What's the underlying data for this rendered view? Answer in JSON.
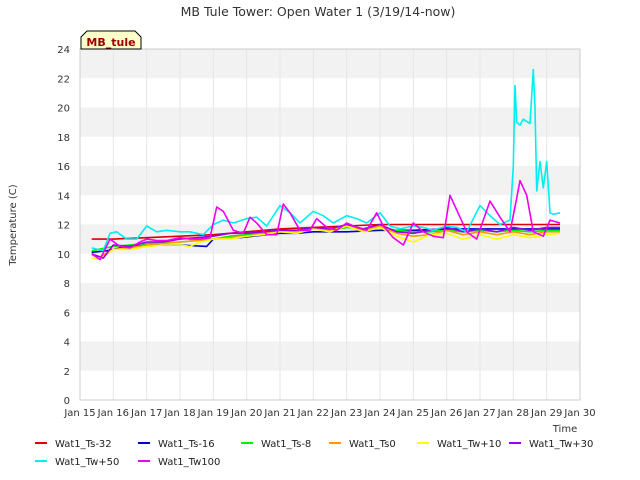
{
  "chart_data": {
    "type": "line",
    "title": "MB Tule Tower: Open Water 1 (3/19/14-now)",
    "site_label": "MB_tule",
    "xlabel": "Time",
    "ylabel": "Temperature (C)",
    "xlim": [
      15,
      30
    ],
    "ylim": [
      0,
      24
    ],
    "x_ticks": [
      15,
      16,
      17,
      18,
      19,
      20,
      21,
      22,
      23,
      24,
      25,
      26,
      27,
      28,
      29,
      30
    ],
    "x_tick_labels": [
      "Jan 15",
      "Jan 16",
      "Jan 17",
      "Jan 18",
      "Jan 19",
      "Jan 20",
      "Jan 21",
      "Jan 22",
      "Jan 23",
      "Jan 24",
      "Jan 25",
      "Jan 26",
      "Jan 27",
      "Jan 28",
      "Jan 29",
      "Jan 30"
    ],
    "y_ticks": [
      0,
      2,
      4,
      6,
      8,
      10,
      12,
      14,
      16,
      18,
      20,
      22,
      24
    ],
    "y_tick_labels": [
      "0",
      "2",
      "4",
      "6",
      "8",
      "10",
      "12",
      "14",
      "16",
      "18",
      "20",
      "22",
      "24"
    ],
    "grid": true,
    "legend_position": "bottom",
    "series": [
      {
        "name": "Wat1_Ts-32",
        "color": "#dd0000",
        "x": [
          15.35,
          16,
          17,
          18,
          19,
          20,
          21,
          22,
          23,
          24,
          25,
          26,
          27,
          28,
          29,
          29.4
        ],
        "y": [
          11.0,
          11.0,
          11.1,
          11.2,
          11.3,
          11.5,
          11.7,
          11.8,
          11.9,
          12.0,
          12.0,
          12.0,
          12.0,
          12.0,
          12.0,
          12.0
        ]
      },
      {
        "name": "Wat1_Ts-16",
        "color": "#0000cc",
        "x": [
          15.35,
          15.8,
          16.2,
          17,
          18,
          18.8,
          19,
          19.8,
          20.2,
          21,
          21.5,
          22,
          23,
          24,
          25,
          26,
          27,
          28,
          29,
          29.4
        ],
        "y": [
          10.1,
          10.2,
          10.4,
          10.6,
          10.6,
          10.5,
          11.0,
          11.1,
          11.2,
          11.4,
          11.4,
          11.5,
          11.5,
          11.6,
          11.6,
          11.7,
          11.7,
          11.7,
          11.7,
          11.7
        ]
      },
      {
        "name": "Wat1_Ts-8",
        "color": "#00ee00",
        "x": [
          15.35,
          16,
          17,
          18,
          19,
          19.5,
          20,
          20.5,
          21,
          21.5,
          22,
          22.5,
          23,
          23.5,
          24,
          24.5,
          25,
          25.5,
          26,
          26.5,
          27,
          27.5,
          28,
          28.5,
          29,
          29.4
        ],
        "y": [
          10.2,
          10.5,
          10.7,
          10.8,
          11.0,
          11.2,
          11.3,
          11.4,
          11.6,
          11.6,
          11.7,
          11.6,
          11.8,
          11.7,
          11.8,
          11.6,
          11.5,
          11.5,
          11.6,
          11.5,
          11.6,
          11.5,
          11.6,
          11.5,
          11.6,
          11.6
        ]
      },
      {
        "name": "Wat1_Ts0",
        "color": "#ff9900",
        "x": [
          15.35,
          15.6,
          16,
          16.5,
          17,
          17.5,
          18,
          18.5,
          19,
          19.5,
          20,
          20.5,
          21,
          21.5,
          22,
          22.5,
          23,
          23.5,
          24,
          24.5,
          25,
          25.5,
          26,
          26.5,
          27,
          27.5,
          28,
          28.5,
          29,
          29.4
        ],
        "y": [
          9.9,
          9.8,
          10.3,
          10.4,
          10.6,
          10.7,
          10.8,
          10.9,
          11.0,
          11.1,
          11.2,
          11.4,
          11.6,
          11.5,
          11.8,
          11.6,
          12.0,
          11.6,
          11.9,
          11.4,
          11.2,
          11.3,
          11.6,
          11.3,
          11.5,
          11.3,
          11.5,
          11.3,
          11.5,
          11.5
        ]
      },
      {
        "name": "Wat1_Tw+10",
        "color": "#ffff00",
        "x": [
          15.35,
          15.6,
          16,
          16.5,
          17,
          17.5,
          18,
          18.3,
          18.6,
          19,
          19.5,
          20,
          20.5,
          21,
          21.5,
          22,
          22.5,
          23,
          23.5,
          24,
          24.5,
          25,
          25.5,
          26,
          26.5,
          27,
          27.5,
          28,
          28.5,
          29,
          29.4
        ],
        "y": [
          9.7,
          9.6,
          10.3,
          10.3,
          10.5,
          10.6,
          10.6,
          10.5,
          10.8,
          11.0,
          11.0,
          11.2,
          11.3,
          11.5,
          11.4,
          11.7,
          11.5,
          11.9,
          11.5,
          11.8,
          11.2,
          10.8,
          11.3,
          11.4,
          11.0,
          11.3,
          11.0,
          11.3,
          11.1,
          11.3,
          11.4
        ]
      },
      {
        "name": "Wat1_Tw+30",
        "color": "#9900ee",
        "x": [
          15.35,
          15.7,
          16,
          16.5,
          17,
          17.5,
          18,
          18.5,
          19,
          19.5,
          20,
          20.5,
          21,
          21.5,
          22,
          22.5,
          23,
          23.5,
          24,
          24.5,
          25,
          25.5,
          26,
          26.5,
          27,
          27.5,
          28,
          28.5,
          29,
          29.4
        ],
        "y": [
          10.0,
          9.7,
          10.6,
          10.5,
          10.8,
          10.8,
          11.0,
          11.1,
          11.2,
          11.4,
          11.4,
          11.5,
          11.6,
          11.6,
          11.8,
          11.7,
          12.0,
          11.7,
          12.0,
          11.5,
          11.4,
          11.6,
          11.8,
          11.5,
          11.7,
          11.5,
          11.8,
          11.6,
          11.8,
          11.8
        ]
      },
      {
        "name": "Wat1_Tw+50",
        "color": "#00eeee",
        "x": [
          15.35,
          15.7,
          15.9,
          16.1,
          16.4,
          16.7,
          17.0,
          17.3,
          17.6,
          18.0,
          18.3,
          18.7,
          19.0,
          19.3,
          19.6,
          20.0,
          20.3,
          20.6,
          21.0,
          21.3,
          21.6,
          22.0,
          22.3,
          22.6,
          23.0,
          23.3,
          23.6,
          24.0,
          24.3,
          24.6,
          25.0,
          25.3,
          25.6,
          26.0,
          26.3,
          26.6,
          27.0,
          27.3,
          27.6,
          27.9,
          28.0,
          28.05,
          28.1,
          28.2,
          28.3,
          28.5,
          28.6,
          28.65,
          28.7,
          28.8,
          28.9,
          29.0,
          29.1,
          29.2,
          29.4
        ],
        "y": [
          10.4,
          10.2,
          11.4,
          11.5,
          11.0,
          11.0,
          11.9,
          11.5,
          11.6,
          11.5,
          11.5,
          11.3,
          12.0,
          12.3,
          12.1,
          12.4,
          12.5,
          11.9,
          13.3,
          12.8,
          12.1,
          12.9,
          12.6,
          12.1,
          12.6,
          12.4,
          12.1,
          12.8,
          11.9,
          11.7,
          11.9,
          11.8,
          11.6,
          11.9,
          11.8,
          11.5,
          13.3,
          12.6,
          12.0,
          12.3,
          16.0,
          21.5,
          19.0,
          18.8,
          19.2,
          18.9,
          22.6,
          20.0,
          14.3,
          16.3,
          14.5,
          16.3,
          12.8,
          12.7,
          12.8
        ]
      },
      {
        "name": "Wat1_Tw100",
        "color": "#ee00ee",
        "x": [
          15.35,
          15.6,
          15.9,
          16.2,
          16.5,
          16.8,
          17.0,
          17.3,
          17.6,
          18.0,
          18.3,
          18.6,
          18.9,
          19.1,
          19.3,
          19.6,
          19.9,
          20.1,
          20.3,
          20.6,
          20.9,
          21.1,
          21.3,
          21.6,
          21.9,
          22.1,
          22.4,
          22.7,
          23.0,
          23.3,
          23.6,
          23.9,
          24.1,
          24.4,
          24.7,
          25.0,
          25.3,
          25.6,
          25.9,
          26.1,
          26.3,
          26.6,
          26.9,
          27.1,
          27.3,
          27.6,
          27.9,
          28.1,
          28.2,
          28.4,
          28.6,
          28.9,
          29.1,
          29.4
        ],
        "y": [
          10.0,
          9.6,
          11.0,
          10.5,
          10.4,
          10.8,
          11.0,
          10.9,
          10.9,
          11.1,
          11.0,
          11.0,
          11.1,
          13.2,
          12.9,
          11.6,
          11.4,
          12.5,
          12.1,
          11.3,
          11.3,
          13.4,
          12.8,
          11.6,
          11.6,
          12.4,
          11.8,
          11.6,
          12.1,
          11.8,
          11.6,
          12.8,
          11.9,
          11.1,
          10.6,
          12.1,
          11.5,
          11.2,
          11.1,
          14.0,
          13.0,
          11.5,
          11.0,
          12.3,
          13.6,
          12.5,
          11.5,
          13.8,
          15.0,
          14.0,
          11.5,
          11.2,
          12.3,
          12.1
        ]
      }
    ]
  }
}
